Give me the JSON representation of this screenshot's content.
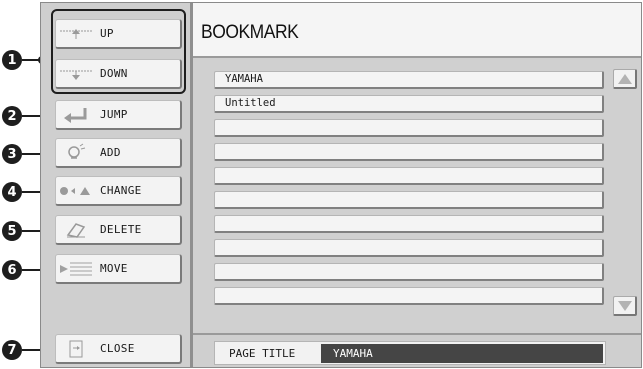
{
  "callouts": [
    "1",
    "2",
    "3",
    "4",
    "5",
    "6",
    "7"
  ],
  "buttons": {
    "up": {
      "label": "UP",
      "icon": "up-arrow-icon"
    },
    "down": {
      "label": "DOWN",
      "icon": "down-arrow-icon"
    },
    "jump": {
      "label": "JUMP",
      "icon": "return-arrow-icon"
    },
    "add": {
      "label": "ADD",
      "icon": "lightbulb-icon"
    },
    "change": {
      "label": "CHANGE",
      "icon": "shape-change-icon"
    },
    "delete": {
      "label": "DELETE",
      "icon": "eraser-icon"
    },
    "move": {
      "label": "MOVE",
      "icon": "list-move-icon"
    },
    "close": {
      "label": "CLOSE",
      "icon": "exit-door-icon"
    }
  },
  "header": {
    "title": "BOOKMARK"
  },
  "bookmarks": [
    "YAMAHA",
    "Untitled",
    "",
    "",
    "",
    "",
    "",
    "",
    "",
    ""
  ],
  "footer": {
    "label": "PAGE TITLE",
    "value": "YAMAHA"
  },
  "colors": {
    "accent": "#454545",
    "panel": "#cfcfcf"
  }
}
